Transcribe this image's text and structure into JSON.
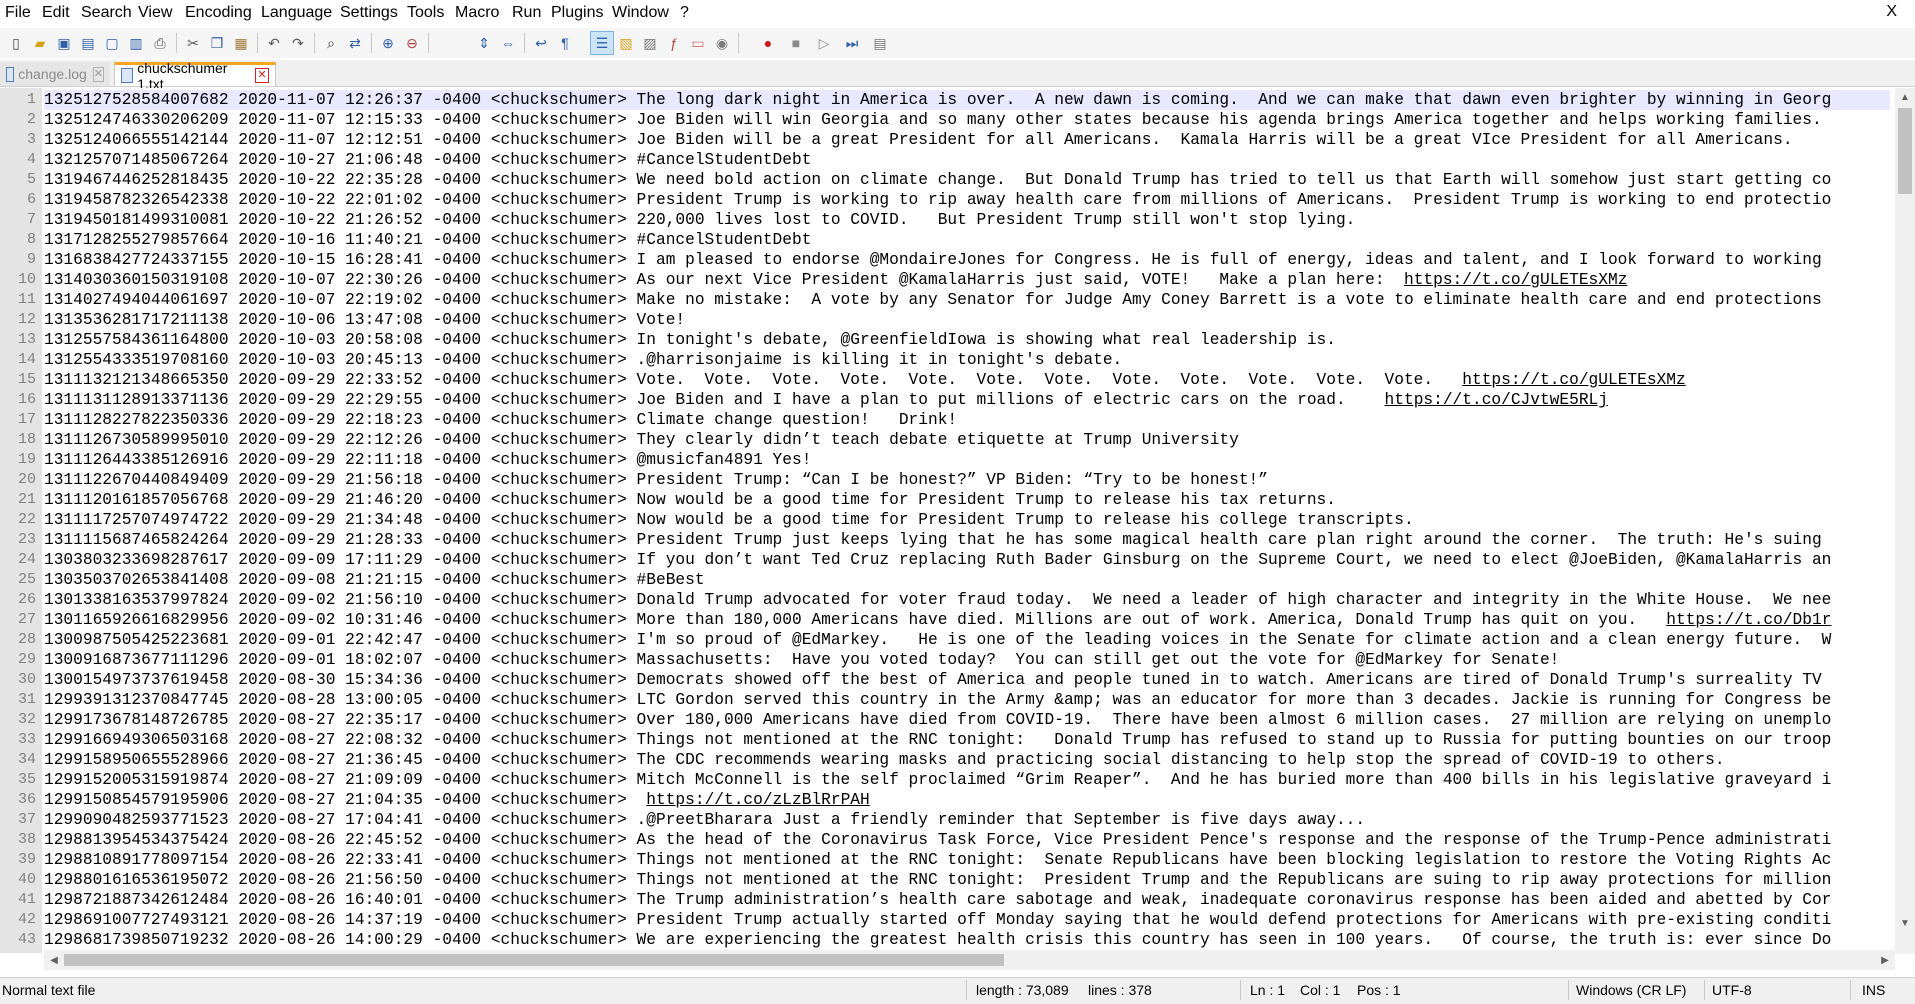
{
  "menu": [
    "File",
    "Edit",
    "Search",
    "View",
    "Encoding",
    "Language",
    "Settings",
    "Tools",
    "Macro",
    "Run",
    "Plugins",
    "Window",
    "?"
  ],
  "window_close": "X",
  "tabs": [
    {
      "label": "change.log",
      "active": false
    },
    {
      "label": "chuckschumer 1.txt",
      "active": true
    }
  ],
  "editor": {
    "lines": [
      "1325127528584007682 2020-11-07 12:26:37 -0400 <chuckschumer> The long dark night in America is over.  A new dawn is coming.  And we can make that dawn even brighter by winning in Georg",
      "1325124746330206209 2020-11-07 12:15:33 -0400 <chuckschumer> Joe Biden will win Georgia and so many other states because his agenda brings America together and helps working families.",
      "1325124066555142144 2020-11-07 12:12:51 -0400 <chuckschumer> Joe Biden will be a great President for all Americans.  Kamala Harris will be a great VIce President for all Americans.",
      "1321257071485067264 2020-10-27 21:06:48 -0400 <chuckschumer> #CancelStudentDebt",
      "1319467446252818435 2020-10-22 22:35:28 -0400 <chuckschumer> We need bold action on climate change.  But Donald Trump has tried to tell us that Earth will somehow just start getting co",
      "1319458782326542338 2020-10-22 22:01:02 -0400 <chuckschumer> President Trump is working to rip away health care from millions of Americans.  President Trump is working to end protectio",
      "1319450181499310081 2020-10-22 21:26:52 -0400 <chuckschumer> 220,000 lives lost to COVID.   But President Trump still won't stop lying.",
      "1317128255279857664 2020-10-16 11:40:21 -0400 <chuckschumer> #CancelStudentDebt",
      "1316838427724337155 2020-10-15 16:28:41 -0400 <chuckschumer> I am pleased to endorse @MondaireJones for Congress. He is full of energy, ideas and talent, and I look forward to working",
      "1314030360150319108 2020-10-07 22:30:26 -0400 <chuckschumer> As our next Vice President @KamalaHarris just said, VOTE!   Make a plan here:  |https://t.co/gULETEsXMz",
      "1314027494044061697 2020-10-07 22:19:02 -0400 <chuckschumer> Make no mistake:  A vote by any Senator for Judge Amy Coney Barrett is a vote to eliminate health care and end protections",
      "1313536281717211138 2020-10-06 13:47:08 -0400 <chuckschumer> Vote!",
      "1312557584361164800 2020-10-03 20:58:08 -0400 <chuckschumer> In tonight's debate, @GreenfieldIowa is showing what real leadership is.",
      "1312554333519708160 2020-10-03 20:45:13 -0400 <chuckschumer> .@harrisonjaime is killing it in tonight's debate.",
      "1311132121348665350 2020-09-29 22:33:52 -0400 <chuckschumer> Vote.  Vote.  Vote.  Vote.  Vote.  Vote.  Vote.  Vote.  Vote.  Vote.  Vote.  Vote.   |https://t.co/gULETEsXMz",
      "1311131128913371136 2020-09-29 22:29:55 -0400 <chuckschumer> Joe Biden and I have a plan to put millions of electric cars on the road.    |https://t.co/CJvtwE5RLj",
      "1311128227822350336 2020-09-29 22:18:23 -0400 <chuckschumer> Climate change question!   Drink!",
      "1311126730589995010 2020-09-29 22:12:26 -0400 <chuckschumer> They clearly didn’t teach debate etiquette at Trump University",
      "1311126443385126916 2020-09-29 22:11:18 -0400 <chuckschumer> @musicfan4891 Yes!",
      "1311122670440849409 2020-09-29 21:56:18 -0400 <chuckschumer> President Trump: “Can I be honest?” VP Biden: “Try to be honest!”",
      "1311120161857056768 2020-09-29 21:46:20 -0400 <chuckschumer> Now would be a good time for President Trump to release his tax returns.",
      "1311117257074974722 2020-09-29 21:34:48 -0400 <chuckschumer> Now would be a good time for President Trump to release his college transcripts.",
      "1311115687465824264 2020-09-29 21:28:33 -0400 <chuckschumer> President Trump just keeps lying that he has some magical health care plan right around the corner.  The truth: He's suing",
      "1303803233698287617 2020-09-09 17:11:29 -0400 <chuckschumer> If you don’t want Ted Cruz replacing Ruth Bader Ginsburg on the Supreme Court, we need to elect @JoeBiden, @KamalaHarris an",
      "1303503702653841408 2020-09-08 21:21:15 -0400 <chuckschumer> #BeBest",
      "1301338163537997824 2020-09-02 21:56:10 -0400 <chuckschumer> Donald Trump advocated for voter fraud today.  We need a leader of high character and integrity in the White House.  We nee",
      "1301165926616829956 2020-09-02 10:31:46 -0400 <chuckschumer> More than 180,000 Americans have died. Millions are out of work. America, Donald Trump has quit on you.   |https://t.co/Db1r",
      "1300987505425223681 2020-09-01 22:42:47 -0400 <chuckschumer> I'm so proud of @EdMarkey.   He is one of the leading voices in the Senate for climate action and a clean energy future.  W",
      "1300916873677111296 2020-09-01 18:02:07 -0400 <chuckschumer> Massachusetts:  Have you voted today?  You can still get out the vote for @EdMarkey for Senate!",
      "1300154973737619458 2020-08-30 15:34:36 -0400 <chuckschumer> Democrats showed off the best of America and people tuned in to watch. Americans are tired of Donald Trump's surreality TV",
      "1299391312370847745 2020-08-28 13:00:05 -0400 <chuckschumer> LTC Gordon served this country in the Army &amp; was an educator for more than 3 decades. Jackie is running for Congress be",
      "1299173678148726785 2020-08-27 22:35:17 -0400 <chuckschumer> Over 180,000 Americans have died from COVID-19.  There have been almost 6 million cases.  27 million are relying on unemplo",
      "1299166949306503168 2020-08-27 22:08:32 -0400 <chuckschumer> Things not mentioned at the RNC tonight:   Donald Trump has refused to stand up to Russia for putting bounties on our troop",
      "1299158950655528966 2020-08-27 21:36:45 -0400 <chuckschumer> The CDC recommends wearing masks and practicing social distancing to help stop the spread of COVID-19 to others.",
      "1299152005315919874 2020-08-27 21:09:09 -0400 <chuckschumer> Mitch McConnell is the self proclaimed “Grim Reaper”.  And he has buried more than 400 bills in his legislative graveyard i",
      "1299150854579195906 2020-08-27 21:04:35 -0400 <chuckschumer>  |https://t.co/zLzBlRrPAH",
      "1299090482593771523 2020-08-27 17:04:41 -0400 <chuckschumer> .@PreetBharara Just a friendly reminder that September is five days away...",
      "1298813954534375424 2020-08-26 22:45:52 -0400 <chuckschumer> As the head of the Coronavirus Task Force, Vice President Pence's response and the response of the Trump-Pence administrati",
      "1298810891778097154 2020-08-26 22:33:41 -0400 <chuckschumer> Things not mentioned at the RNC tonight:  Senate Republicans have been blocking legislation to restore the Voting Rights Ac",
      "1298801616536195072 2020-08-26 21:56:50 -0400 <chuckschumer> Things not mentioned at the RNC tonight:  President Trump and the Republicans are suing to rip away protections for million",
      "1298721887342612484 2020-08-26 16:40:01 -0400 <chuckschumer> The Trump administration’s health care sabotage and weak, inadequate coronavirus response has been aided and abetted by Cor",
      "1298691007727493121 2020-08-26 14:37:19 -0400 <chuckschumer> President Trump actually started off Monday saying that he would defend protections for Americans with pre-existing conditi",
      "1298681739850719232 2020-08-26 14:00:29 -0400 <chuckschumer> We are experiencing the greatest health crisis this country has seen in 100 years.   Of course, the truth is: ever since Do"
    ]
  },
  "status": {
    "file_type": "Normal text file",
    "length": "length : 73,089",
    "lines": "lines : 378",
    "ln": "Ln : 1",
    "col": "Col : 1",
    "pos": "Pos : 1",
    "eol": "Windows (CR LF)",
    "encoding": "UTF-8",
    "mode": "INS"
  },
  "colors": {
    "accent_tab": "#f5a623",
    "current_line": "#e8e8ff",
    "gutter": "#e4e4e4"
  }
}
